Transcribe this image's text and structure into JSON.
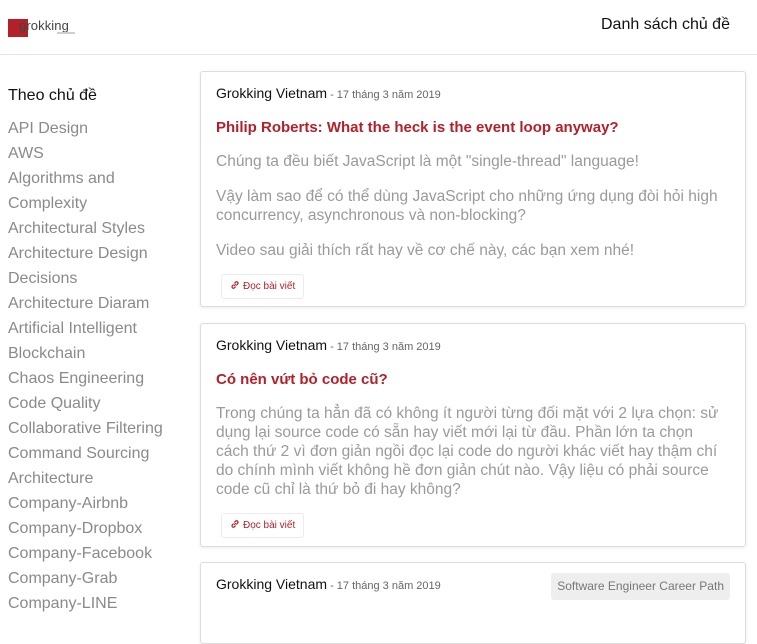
{
  "header": {
    "logo_text": "grokking",
    "nav_topics": "Danh sách chủ đề"
  },
  "sidebar": {
    "title": "Theo chủ đề",
    "items": [
      "API Design",
      "AWS",
      "Algorithms and Complexity",
      "Architectural Styles",
      "Architecture Design Decisions",
      "Architecture Diaram",
      "Artificial Intelligent",
      "Blockchain",
      "Chaos Engineering",
      "Code Quality",
      "Collaborative Filtering",
      "Command Sourcing Architecture",
      "Company-Airbnb",
      "Company-Dropbox",
      "Company-Facebook",
      "Company-Grab",
      "Company-LINE"
    ]
  },
  "posts": [
    {
      "author": "Grokking Vietnam",
      "date": " - 17 tháng 3 năm 2019",
      "title": "Philip Roberts: What the heck is the event loop anyway?",
      "body": [
        "Chúng ta đều biết JavaScript là một \"single-thread\" language!",
        "Vậy làm sao để có thể dùng JavaScript cho những ứng dụng đòi hỏi high concurrency, asynchronous và non-blocking?",
        "Video sau giải thích rất hay về cơ chế này, các bạn xem nhé!"
      ],
      "read_label": "Đọc bài viết"
    },
    {
      "author": "Grokking Vietnam",
      "date": " - 17 tháng 3 năm 2019",
      "title": "Có nên vứt bỏ code cũ?",
      "body": [
        "Trong chúng ta hẳn đã có không ít người từng đối mặt với 2 lựa chọn: sử dụng lại source code có sẵn hay viết mới lại từ đầu. Phần lớn ta chọn cách thứ 2 vì đơn giản ngồi đọc lại code do người khác viết hay thậm chí do chính mình viết không hề đơn giản chút nào. Vậy liệu có phải source code cũ chỉ là thứ bỏ đi hay không?"
      ],
      "read_label": "Đọc bài viết"
    },
    {
      "author": "Grokking Vietnam",
      "date": " - 17 tháng 3 năm 2019",
      "tag": "Software Engineer Career Path"
    }
  ],
  "colors": {
    "accent": "#b3202a",
    "muted_text": "#9a9a9a",
    "sidebar_text": "#8a8a8a",
    "tag_bg": "#eeeeee"
  }
}
